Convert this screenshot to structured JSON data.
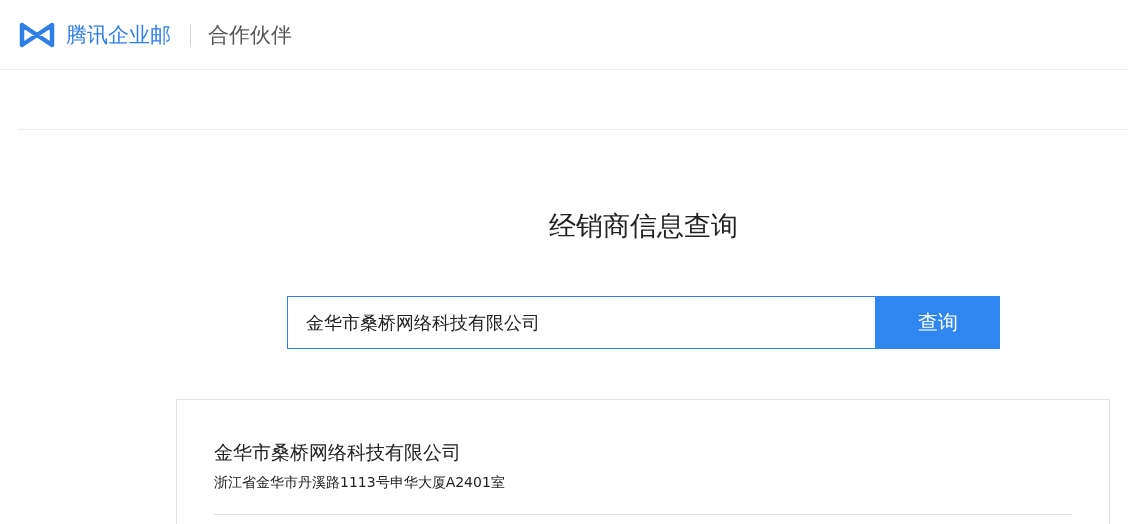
{
  "header": {
    "brand": "腾讯企业邮",
    "section": "合作伙伴"
  },
  "title": "经销商信息查询",
  "search": {
    "value": "金华市桑桥网络科技有限公司",
    "button": "查询"
  },
  "results": [
    {
      "name": "金华市桑桥网络科技有限公司",
      "address": "浙江省金华市丹溪路1113号申华大厦A2401室"
    }
  ]
}
